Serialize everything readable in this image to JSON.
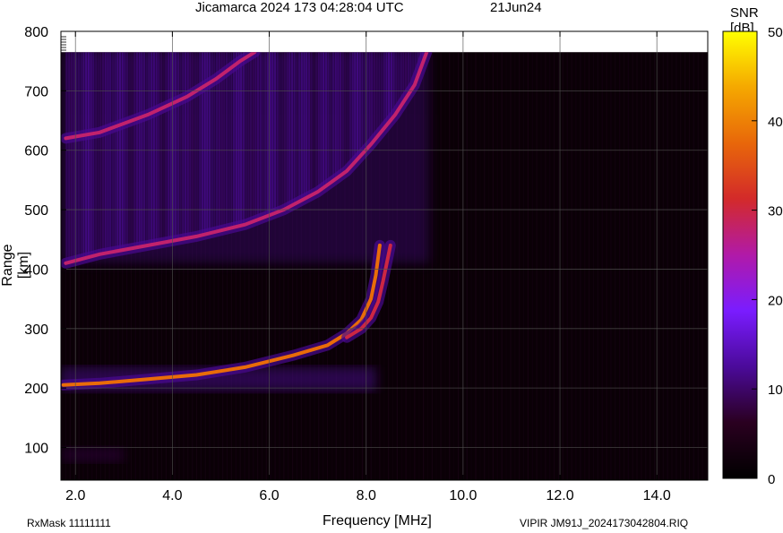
{
  "header": {
    "title": "Jicamarca 2024 173 04:28:04 UTC",
    "date": "21Jun24"
  },
  "footer": {
    "rxmask": "RxMask 11111111",
    "file": "VIPIR  JM91J_2024173042804.RIQ"
  },
  "colorbar": {
    "label": "SNR [dB]",
    "range": [
      0,
      50
    ],
    "ticks": [
      0,
      10,
      20,
      30,
      40,
      50
    ],
    "stops": [
      "#000000",
      "#2a0020",
      "#4b0a9a",
      "#7a1cff",
      "#b11aa8",
      "#d32a2a",
      "#e8670a",
      "#f5a800",
      "#ffff00"
    ]
  },
  "chart_data": {
    "type": "heatmap",
    "title": "Jicamarca 2024 173 04:28:04 UTC",
    "xlabel": "Frequency [MHz]",
    "ylabel": "Range [km]",
    "xlim": [
      1.7,
      15.05
    ],
    "ylim": [
      45,
      800
    ],
    "xticks": [
      "2.0",
      "4.0",
      "6.0",
      "8.0",
      "10.0",
      "12.0",
      "14.0"
    ],
    "xtick_values": [
      2,
      4,
      6,
      8,
      10,
      12,
      14
    ],
    "yticks": [
      100,
      200,
      300,
      400,
      500,
      600,
      700,
      800
    ],
    "grid": true,
    "data_top_km": 765,
    "echo_traces": [
      {
        "name": "E/F1 trace",
        "snr_db": 38,
        "points": [
          [
            1.75,
            205
          ],
          [
            2.5,
            208
          ],
          [
            3.5,
            215
          ],
          [
            4.5,
            222
          ],
          [
            5.5,
            235
          ],
          [
            6.5,
            255
          ],
          [
            7.2,
            272
          ],
          [
            7.6,
            292
          ],
          [
            7.9,
            315
          ],
          [
            8.1,
            350
          ],
          [
            8.2,
            390
          ],
          [
            8.28,
            440
          ]
        ]
      },
      {
        "name": "E/F1 trace x",
        "snr_db": 30,
        "points": [
          [
            7.6,
            285
          ],
          [
            7.9,
            300
          ],
          [
            8.1,
            318
          ],
          [
            8.25,
            345
          ],
          [
            8.35,
            380
          ],
          [
            8.45,
            420
          ],
          [
            8.5,
            440
          ]
        ]
      },
      {
        "name": "F2 trace",
        "snr_db": 28,
        "points": [
          [
            1.8,
            410
          ],
          [
            2.5,
            425
          ],
          [
            3.5,
            440
          ],
          [
            4.5,
            455
          ],
          [
            5.5,
            475
          ],
          [
            6.3,
            500
          ],
          [
            7.0,
            530
          ],
          [
            7.6,
            565
          ],
          [
            8.1,
            610
          ],
          [
            8.6,
            660
          ],
          [
            9.0,
            710
          ],
          [
            9.25,
            765
          ]
        ]
      },
      {
        "name": "multi-hop trace",
        "snr_db": 28,
        "points": [
          [
            1.8,
            620
          ],
          [
            2.5,
            630
          ],
          [
            3.5,
            660
          ],
          [
            4.3,
            690
          ],
          [
            4.9,
            720
          ],
          [
            5.4,
            750
          ],
          [
            5.7,
            765
          ]
        ]
      }
    ],
    "spread_regions": [
      {
        "snr_db": 12,
        "f_min": 1.7,
        "f_max": 9.3,
        "range_min": 410,
        "range_max": 765
      },
      {
        "snr_db": 12,
        "f_min": 1.7,
        "f_max": 8.2,
        "range_min": 195,
        "range_max": 235
      },
      {
        "snr_db": 8,
        "f_min": 1.7,
        "f_max": 3.0,
        "range_min": 75,
        "range_max": 100
      }
    ]
  }
}
